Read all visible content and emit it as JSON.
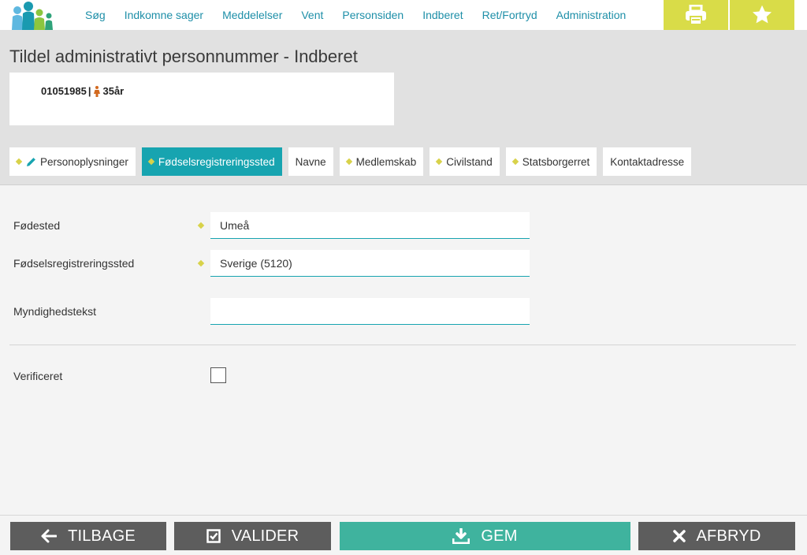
{
  "nav": {
    "items": [
      {
        "label": "Søg"
      },
      {
        "label": "Indkomne sager"
      },
      {
        "label": "Meddelelser"
      },
      {
        "label": "Vent"
      },
      {
        "label": "Personsiden"
      },
      {
        "label": "Indberet"
      },
      {
        "label": "Ret/Fortryd"
      },
      {
        "label": "Administration"
      }
    ],
    "print_icon": "printer-icon",
    "star_icon": "star-icon"
  },
  "header": {
    "title": "Tildel administrativt personnummer - Indberet",
    "person": {
      "cpr": "01051985",
      "separator": "|",
      "age": "35år",
      "gender_icon": "female-person-icon"
    }
  },
  "tabs": [
    {
      "label": "Personoplysninger",
      "required": true,
      "edited": true,
      "active": false
    },
    {
      "label": "Fødselsregistreringssted",
      "required": true,
      "active": true
    },
    {
      "label": "Navne",
      "required": false,
      "active": false
    },
    {
      "label": "Medlemskab",
      "required": true,
      "active": false
    },
    {
      "label": "Civilstand",
      "required": true,
      "active": false
    },
    {
      "label": "Statsborgerret",
      "required": true,
      "active": false
    },
    {
      "label": "Kontaktadresse",
      "required": false,
      "active": false
    }
  ],
  "form": {
    "fodested": {
      "label": "Fødested",
      "value": "Umeå",
      "required": true
    },
    "registreringssted": {
      "label": "Fødselsregistreringssted",
      "value": "Sverige (5120)",
      "required": true
    },
    "myndighedstekst": {
      "label": "Myndighedstekst",
      "value": "",
      "required": false
    },
    "verificeret": {
      "label": "Verificeret",
      "checked": false
    }
  },
  "footer": {
    "back": {
      "label": "TILBAGE",
      "icon": "arrow-left-icon"
    },
    "validate": {
      "label": "VALIDER",
      "icon": "checkbox-checked-icon"
    },
    "save": {
      "label": "GEM",
      "icon": "download-icon"
    },
    "cancel": {
      "label": "AFBRYD",
      "icon": "close-icon"
    }
  },
  "colors": {
    "accent": "#17a4b0",
    "save": "#3fb39e",
    "highlight": "#d9dc48",
    "required_marker": "#d8d24a",
    "footer_button": "#5d5d5d",
    "nav_link": "#1e8fa8"
  }
}
